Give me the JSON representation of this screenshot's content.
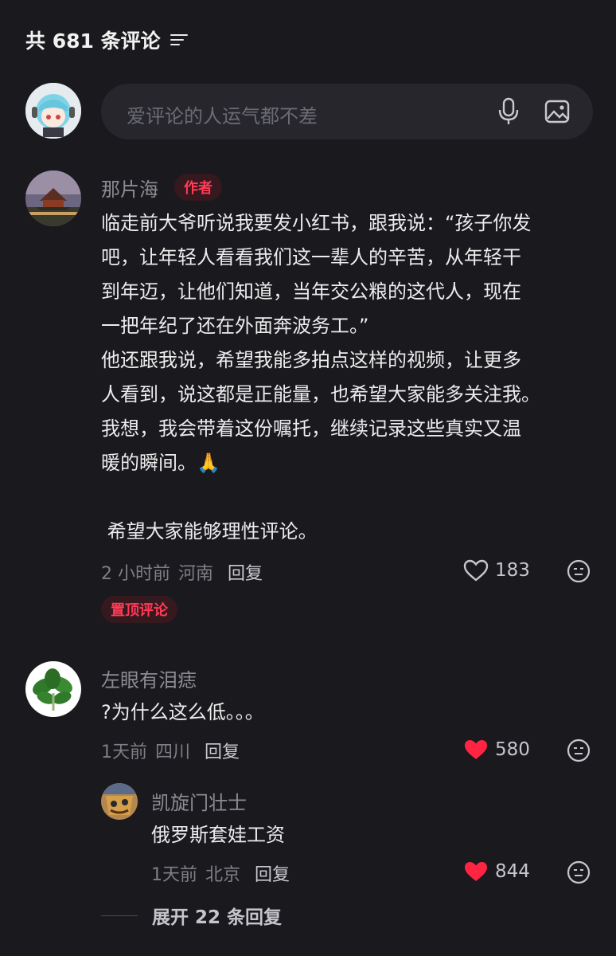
{
  "header": {
    "title": "共 681 条评论"
  },
  "input": {
    "placeholder": "爱评论的人运气都不差"
  },
  "comments": [
    {
      "user": "那片海",
      "badge": "作者",
      "text": "临走前大爷听说我要发小红书，跟我说：“孩子你发\n吧，让年轻人看看我们这一辈人的辛苦，从年轻干\n到年迈，让他们知道，当年交公粮的这代人，现在\n一把年纪了还在外面奔波务工。”\n他还跟我说，希望我能多拍点这样的视频，让更多\n人看到，说这都是正能量，也希望大家能多关注我。\n我想，我会带着这份嘱托，继续记录这些真实又温\n暖的瞬间。🙏\n\n 希望大家能够理性评论。",
      "time": "2 小时前",
      "location": "河南",
      "reply_label": "回复",
      "likes": "183",
      "liked": false,
      "pinned_label": "置顶评论"
    },
    {
      "user": "左眼有泪痣",
      "text": "?为什么这么低。。。",
      "time": "1天前",
      "location": "四川",
      "reply_label": "回复",
      "likes": "580",
      "liked": true,
      "replies": [
        {
          "user": "凯旋门壮士",
          "text": "俄罗斯套娃工资",
          "time": "1天前",
          "location": "北京",
          "reply_label": "回复",
          "likes": "844",
          "liked": true
        }
      ]
    }
  ],
  "expand_label": "展开 22 条回复",
  "colors": {
    "background": "#19191e",
    "accent": "#ff2442",
    "badge_bg": "#36181f"
  }
}
